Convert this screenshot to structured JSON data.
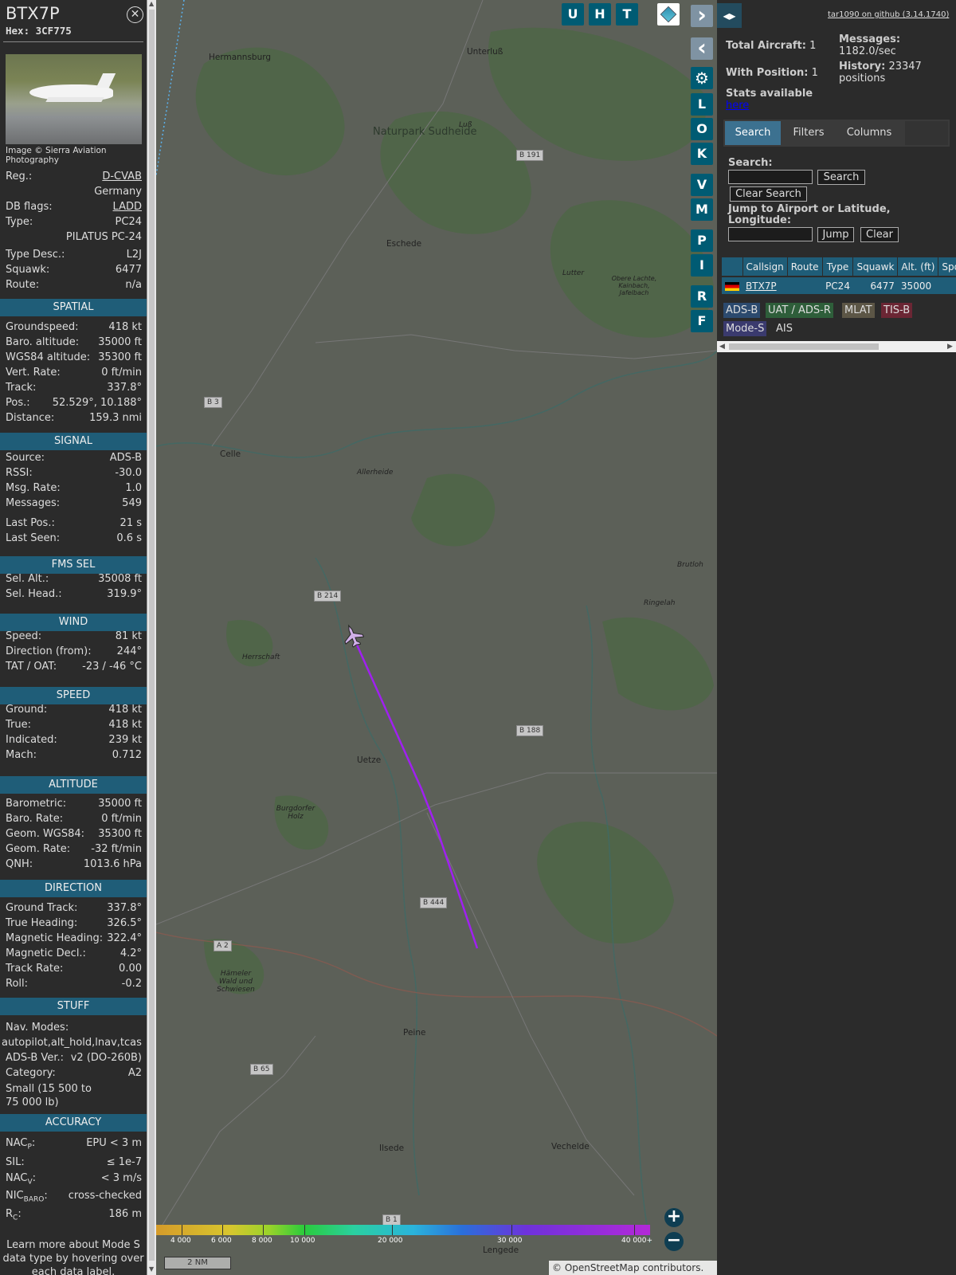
{
  "info": {
    "callsign": "BTX7P",
    "hex": "Hex: 3CF775",
    "photo_credit": "Image © Sierra Aviation Photography",
    "reg_label": "Reg.:",
    "reg": "D-CVAB",
    "country": "Germany",
    "dbflags_label": "DB flags:",
    "dbflags": "LADD",
    "type_label": "Type:",
    "type": "PC24",
    "type_full": "PILATUS PC-24",
    "typedesc_label": "Type Desc.:",
    "typedesc": "L2J",
    "squawk_label": "Squawk:",
    "squawk": "6477",
    "route_label": "Route:",
    "route": "n/a",
    "sections": {
      "spatial": "SPATIAL",
      "signal": "SIGNAL",
      "fms": "FMS SEL",
      "wind": "WIND",
      "speed": "SPEED",
      "altitude": "ALTITUDE",
      "direction": "DIRECTION",
      "stuff": "STUFF",
      "accuracy": "ACCURACY"
    },
    "spatial": [
      {
        "k": "Groundspeed:",
        "v": "418 kt"
      },
      {
        "k": "Baro. altitude:",
        "v": "35000 ft"
      },
      {
        "k": "WGS84 altitude:",
        "v": "35300 ft"
      },
      {
        "k": "Vert. Rate:",
        "v": "0 ft/min"
      },
      {
        "k": "Track:",
        "v": "337.8°"
      },
      {
        "k": "Pos.:",
        "v": "52.529°, 10.188°"
      },
      {
        "k": "Distance:",
        "v": "159.3 nmi"
      }
    ],
    "signal": [
      {
        "k": "Source:",
        "v": "ADS-B"
      },
      {
        "k": "RSSI:",
        "v": "-30.0"
      },
      {
        "k": "Msg. Rate:",
        "v": "1.0"
      },
      {
        "k": "Messages:",
        "v": "549"
      },
      {
        "k": "Last Pos.:",
        "v": "21 s"
      },
      {
        "k": "Last Seen:",
        "v": "0.6 s"
      }
    ],
    "fms": [
      {
        "k": "Sel. Alt.:",
        "v": "35008 ft"
      },
      {
        "k": "Sel. Head.:",
        "v": "319.9°"
      }
    ],
    "wind": [
      {
        "k": "Speed:",
        "v": "81 kt"
      },
      {
        "k": "Direction (from):",
        "v": "244°"
      },
      {
        "k": "TAT / OAT:",
        "v": "-23 / -46 °C"
      }
    ],
    "speed": [
      {
        "k": "Ground:",
        "v": "418 kt"
      },
      {
        "k": "True:",
        "v": "418 kt"
      },
      {
        "k": "Indicated:",
        "v": "239 kt"
      },
      {
        "k": "Mach:",
        "v": "0.712"
      }
    ],
    "altitude": [
      {
        "k": "Barometric:",
        "v": "35000 ft"
      },
      {
        "k": "Baro. Rate:",
        "v": "0 ft/min"
      },
      {
        "k": "Geom. WGS84:",
        "v": "35300 ft"
      },
      {
        "k": "Geom. Rate:",
        "v": "-32 ft/min"
      },
      {
        "k": "QNH:",
        "v": "1013.6 hPa"
      }
    ],
    "direction": [
      {
        "k": "Ground Track:",
        "v": "337.8°"
      },
      {
        "k": "True Heading:",
        "v": "326.5°"
      },
      {
        "k": "Magnetic Heading:",
        "v": "322.4°"
      },
      {
        "k": "Magnetic Decl.:",
        "v": "4.2°"
      },
      {
        "k": "Track Rate:",
        "v": "0.00"
      },
      {
        "k": "Roll:",
        "v": "-0.2"
      }
    ],
    "stuff": {
      "navmodes_label": "Nav. Modes:",
      "navmodes": "autopilot,alt_hold,lnav,tcas",
      "adsb_label": "ADS-B Ver.:",
      "adsb": "v2 (DO-260B)",
      "category_label": "Category:",
      "category": "A2",
      "category_desc": "Small (15 500 to 75 000 lb)"
    },
    "accuracy": {
      "nacp_pre": "NAC",
      "nacp_sub": "P",
      "nacp_post": ":",
      "nacp": "EPU < 3 m",
      "sil_label": "SIL:",
      "sil": "≤ 1e-7",
      "nacv_pre": "NAC",
      "nacv_sub": "V",
      "nacv_post": ":",
      "nacv": "< 3 m/s",
      "nicbaro_pre": "NIC",
      "nicbaro_sub": "BARO",
      "nicbaro_post": ":",
      "nicbaro": "cross-checked",
      "rc_pre": "R",
      "rc_sub": "C",
      "rc_post": ":",
      "rc": "186 m"
    },
    "footer": "Learn more about Mode S data type by hovering over each data label."
  },
  "map": {
    "places": {
      "hermannsburg": "Hermannsburg",
      "unterluss": "Unterluß",
      "naturpark": "Naturpark Sudheide",
      "eschede": "Eschede",
      "celle": "Celle",
      "uetze": "Uetze",
      "peine": "Peine",
      "ilsede": "Ilsede",
      "vechelde": "Vechelde",
      "lengede": "Lengede",
      "herrschaft": "Herrschaft",
      "burgdorfer": "Burgdorfer Holz",
      "hameler": "Hämeler Wald und Schwiesen",
      "allerheide": "Allerheide",
      "ringelah": "Ringelah",
      "brutloh": "Brutloh",
      "lutter": "Lutter",
      "kainbach": "Obere Lachte, Kainbach, Jafelbach",
      "luss": "Luß"
    },
    "roads": {
      "b191": "B 191",
      "b3": "B 3",
      "b214": "B 214",
      "b188": "B 188",
      "b444": "B 444",
      "a2": "A 2",
      "b65": "B 65",
      "b1": "B 1"
    },
    "buttons": {
      "u": "U",
      "h": "H",
      "t": "T",
      "next": "›",
      "prev": "‹",
      "l": "L",
      "o": "O",
      "k": "K",
      "v": "V",
      "m": "M",
      "p": "P",
      "i": "I",
      "r": "R",
      "f": "F"
    },
    "zoom_in": "+",
    "zoom_out": "−",
    "legend": [
      "4 000",
      "6 000",
      "8 000",
      "10 000",
      "20 000",
      "30 000",
      "40 000+"
    ],
    "scale": "2 NM",
    "attribution": "© OpenStreetMap contributors."
  },
  "side": {
    "toggle": "◂▸",
    "github": "tar1090 on github (3.14.1740)",
    "total_label": "Total Aircraft:",
    "total": "1",
    "withpos_label": "With Position:",
    "withpos": "1",
    "messages_label": "Messages:",
    "messages": "1182.0/sec",
    "history_label": "History:",
    "history": "23347 positions",
    "stats_label": "Stats available",
    "stats_link": "here",
    "tabs": {
      "search": "Search",
      "filters": "Filters",
      "columns": "Columns"
    },
    "search_label": "Search:",
    "search_btn": "Search",
    "clear_search": "Clear Search",
    "jump_label": "Jump to Airport or Latitude, Longitude:",
    "jump_btn": "Jump",
    "clear_btn": "Clear",
    "table": {
      "headers": [
        "",
        "Callsign",
        "Route",
        "Type",
        "Squawk",
        "Alt. (ft)",
        "Spd."
      ],
      "row": {
        "callsign": "BTX7P",
        "route": "",
        "type": "PC24",
        "squawk": "6477",
        "alt": "35000",
        "spd": ""
      }
    },
    "badges": {
      "adsb": "ADS-B",
      "uat": "UAT / ADS-R",
      "mlat": "MLAT",
      "tisb": "TIS-B",
      "modes": "Mode-S",
      "ais": "AIS"
    }
  },
  "colors": {
    "accent": "#1f5d78",
    "track": "#a020f0",
    "button": "#005b73"
  }
}
